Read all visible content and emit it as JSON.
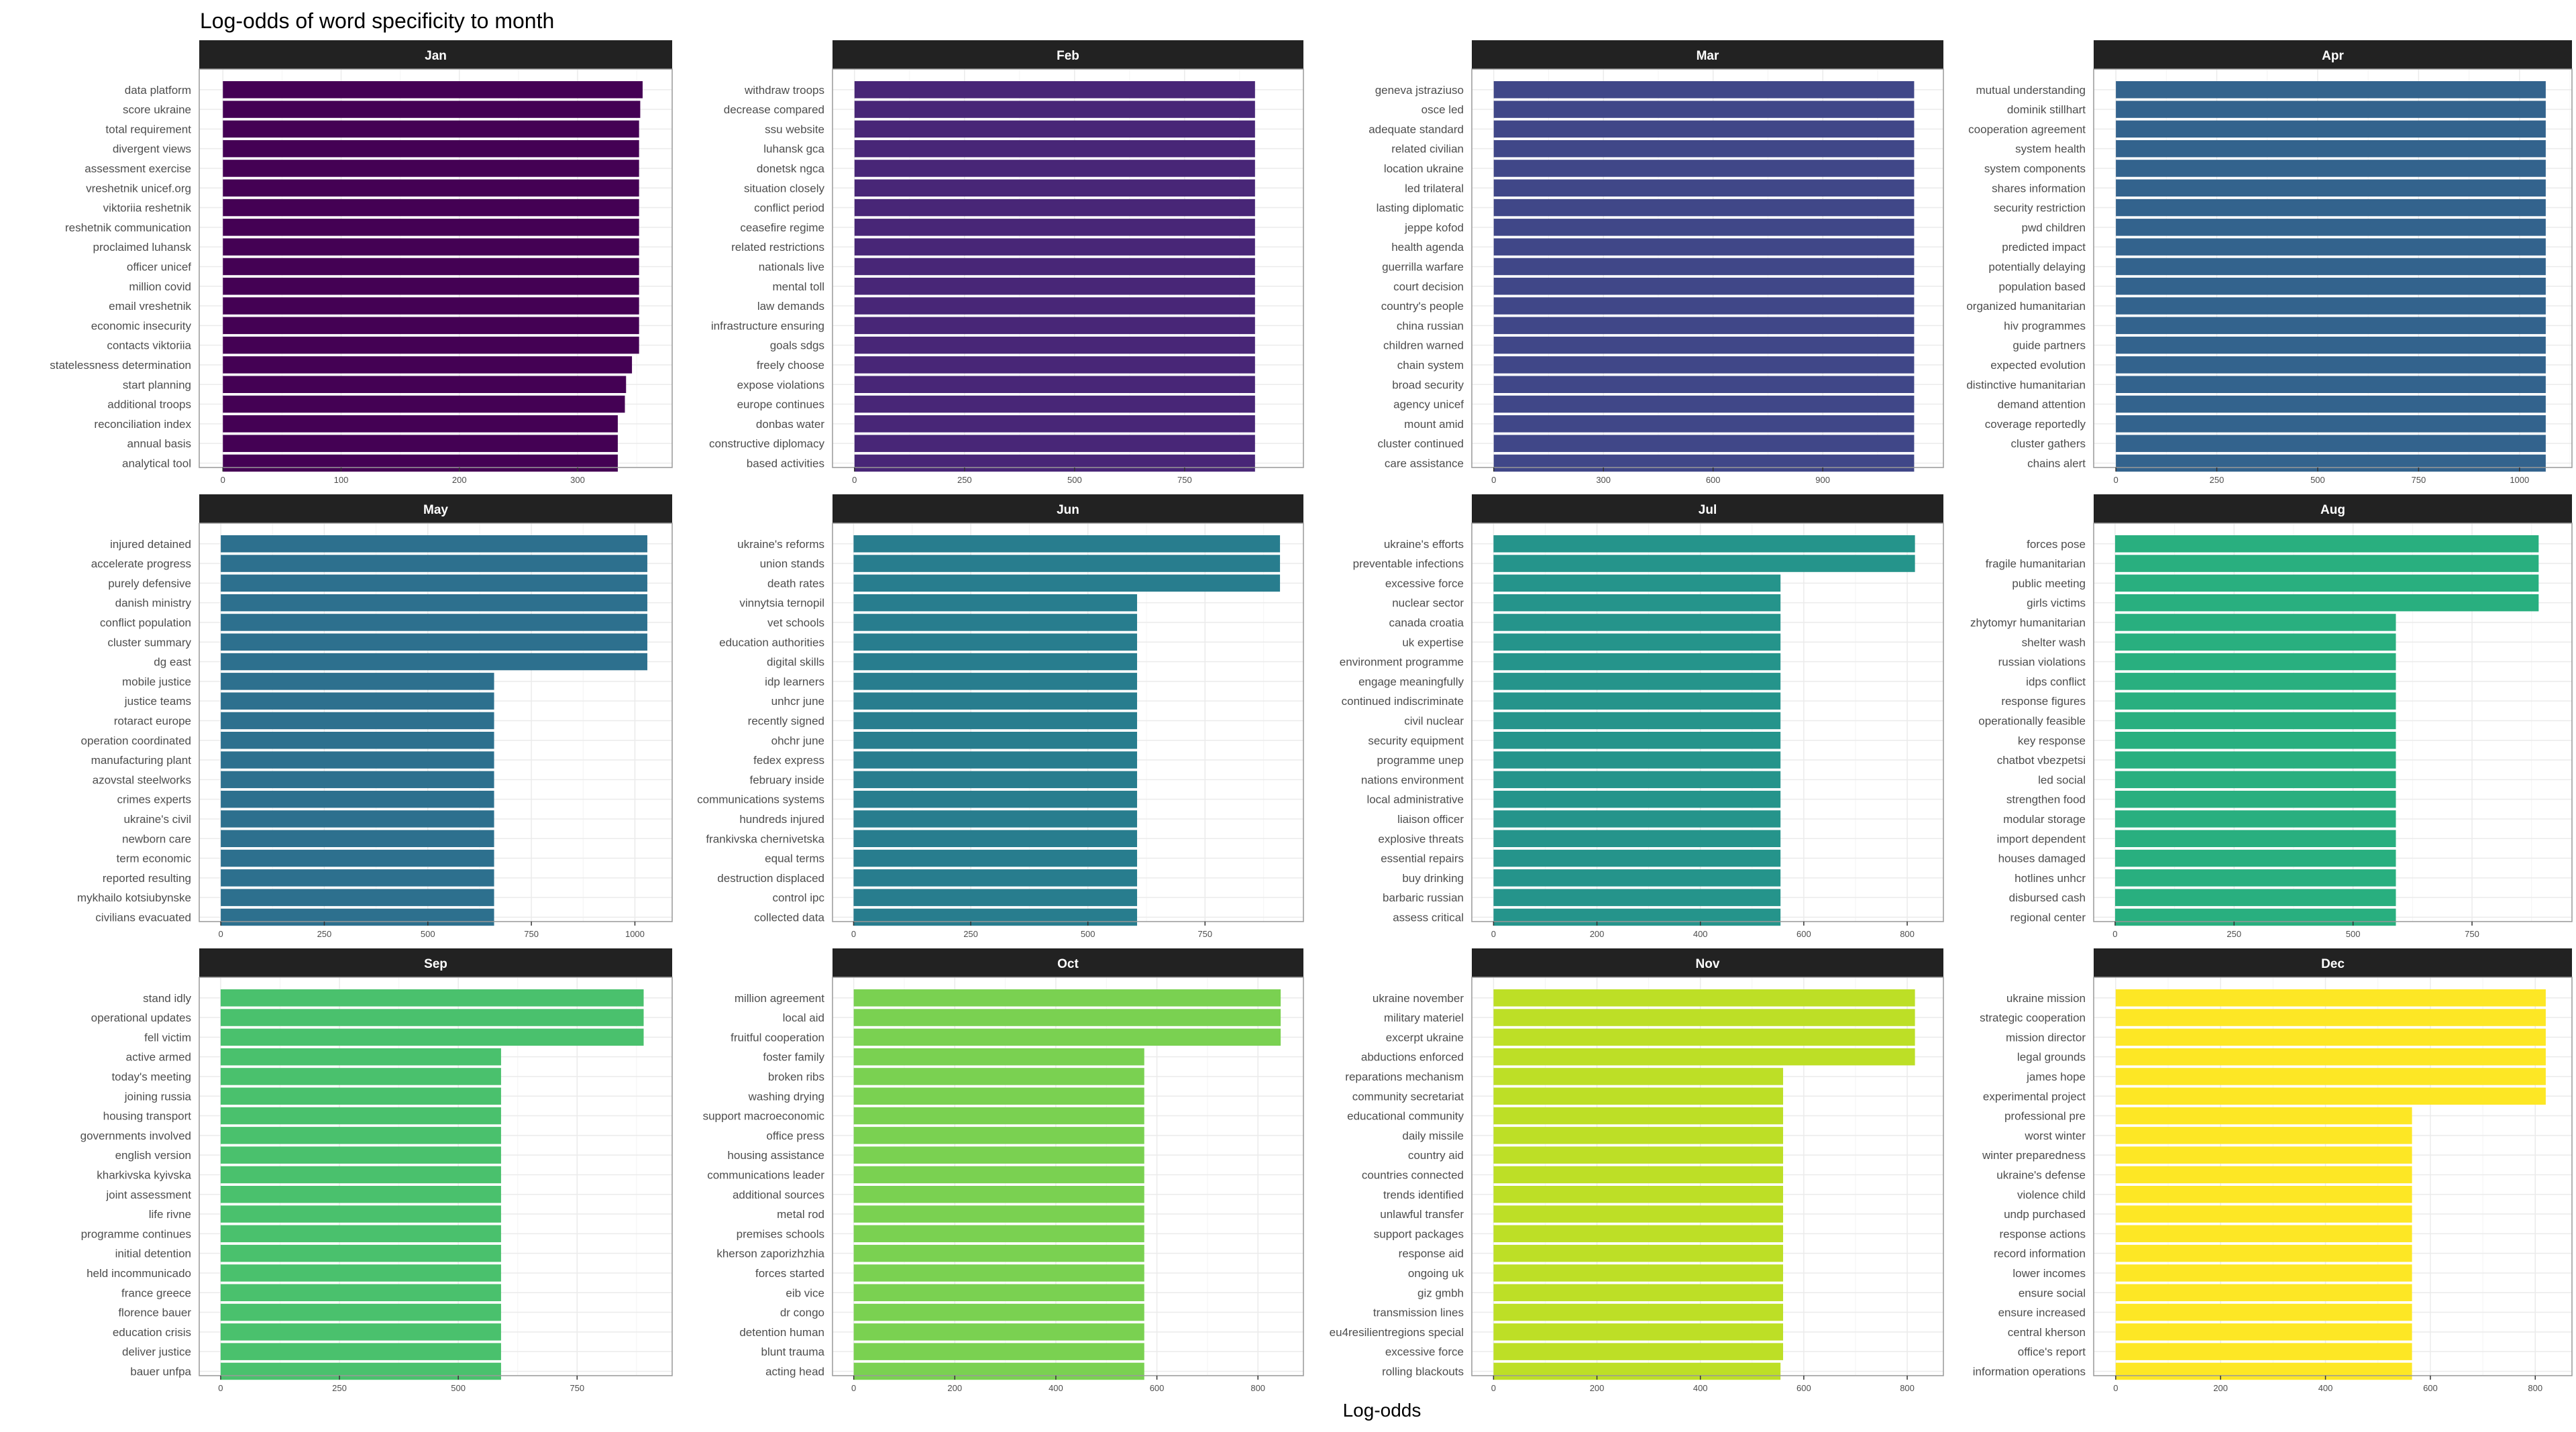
{
  "title": "Log-odds of word specificity to month",
  "xlabel": "Log-odds",
  "colors": {
    "strip_bg": "#222222",
    "strip_text": "#ffffff",
    "grid": "#ebebeb",
    "panel_border": "#999999",
    "label_text": "#4d4d4d",
    "tick_text": "#4d4d4d"
  },
  "chart_data": [
    {
      "type": "bar",
      "orientation": "horizontal",
      "panel": "Jan",
      "color": "#440154",
      "xlim": [
        -20,
        380
      ],
      "xticks": [
        0,
        100,
        200,
        300
      ],
      "categories": [
        "data platform",
        "score ukraine",
        "total requirement",
        "divergent views",
        "assessment exercise",
        "vreshetnik unicef.org",
        "viktoriia reshetnik",
        "reshetnik communication",
        "proclaimed luhansk",
        "officer unicef",
        "million covid",
        "email vreshetnik",
        "economic insecurity",
        "contacts viktoriia",
        "statelessness determination",
        "start planning",
        "additional troops",
        "reconciliation index",
        "annual basis",
        "analytical tool"
      ],
      "values": [
        355,
        353,
        352,
        352,
        352,
        352,
        352,
        352,
        352,
        352,
        352,
        352,
        352,
        352,
        346,
        341,
        340,
        334,
        334,
        334
      ]
    },
    {
      "type": "bar",
      "orientation": "horizontal",
      "panel": "Feb",
      "color": "#482677",
      "xlim": [
        -50,
        1020
      ],
      "xticks": [
        0,
        250,
        500,
        750
      ],
      "categories": [
        "withdraw troops",
        "decrease compared",
        "ssu website",
        "luhansk gca",
        "donetsk ngca",
        "situation closely",
        "conflict period",
        "ceasefire regime",
        "related restrictions",
        "nationals live",
        "mental toll",
        "law demands",
        "infrastructure ensuring",
        "goals sdgs",
        "freely choose",
        "expose violations",
        "europe continues",
        "donbas water",
        "constructive diplomacy",
        "based activities"
      ],
      "values": [
        910,
        910,
        910,
        910,
        910,
        910,
        910,
        910,
        910,
        910,
        910,
        910,
        910,
        910,
        910,
        910,
        910,
        910,
        910,
        910
      ]
    },
    {
      "type": "bar",
      "orientation": "horizontal",
      "panel": "Mar",
      "color": "#404788",
      "xlim": [
        -60,
        1230
      ],
      "xticks": [
        0,
        300,
        600,
        900
      ],
      "categories": [
        "geneva jstraziuso",
        "osce led",
        "adequate standard",
        "related civilian",
        "location ukraine",
        "led trilateral",
        "lasting diplomatic",
        "jeppe kofod",
        "health agenda",
        "guerrilla warfare",
        "court decision",
        "country's people",
        "china russian",
        "children warned",
        "chain system",
        "broad security",
        "agency unicef",
        "mount amid",
        "cluster continued",
        "care assistance"
      ],
      "values": [
        1150,
        1150,
        1150,
        1150,
        1150,
        1150,
        1150,
        1150,
        1150,
        1150,
        1150,
        1150,
        1150,
        1150,
        1150,
        1150,
        1150,
        1150,
        1150,
        1150
      ]
    },
    {
      "type": "bar",
      "orientation": "horizontal",
      "panel": "Apr",
      "color": "#33638d",
      "xlim": [
        -55,
        1130
      ],
      "xticks": [
        0,
        250,
        500,
        750,
        1000
      ],
      "categories": [
        "mutual understanding",
        "dominik stillhart",
        "cooperation agreement",
        "system health",
        "system components",
        "shares information",
        "security restriction",
        "pwd children",
        "predicted impact",
        "potentially delaying",
        "population based",
        "organized humanitarian",
        "hiv programmes",
        "guide partners",
        "expected evolution",
        "distinctive humanitarian",
        "demand attention",
        "coverage reportedly",
        "cluster gathers",
        "chains alert"
      ],
      "values": [
        1065,
        1065,
        1065,
        1065,
        1065,
        1065,
        1065,
        1065,
        1065,
        1065,
        1065,
        1065,
        1065,
        1065,
        1065,
        1065,
        1065,
        1065,
        1065,
        1065
      ]
    },
    {
      "type": "bar",
      "orientation": "horizontal",
      "panel": "May",
      "color": "#2d708e",
      "xlim": [
        -52,
        1090
      ],
      "xticks": [
        0,
        250,
        500,
        750,
        1000
      ],
      "categories": [
        "injured detained",
        "accelerate progress",
        "purely defensive",
        "danish ministry",
        "conflict population",
        "cluster summary",
        "dg east",
        "mobile justice",
        "justice teams",
        "rotaract europe",
        "operation coordinated",
        "manufacturing plant",
        "azovstal steelworks",
        "crimes experts",
        "ukraine's civil",
        "newborn care",
        "term economic",
        "reported resulting",
        "mykhailo kotsiubynske",
        "civilians evacuated"
      ],
      "values": [
        1030,
        1030,
        1030,
        1030,
        1030,
        1030,
        1030,
        660,
        660,
        660,
        660,
        660,
        660,
        660,
        660,
        660,
        660,
        660,
        660,
        660
      ]
    },
    {
      "type": "bar",
      "orientation": "horizontal",
      "panel": "Jun",
      "color": "#287d8e",
      "xlim": [
        -45,
        960
      ],
      "xticks": [
        0,
        250,
        500,
        750
      ],
      "categories": [
        "ukraine's reforms",
        "union stands",
        "death rates",
        "vinnytsia ternopil",
        "vet schools",
        "education authorities",
        "digital skills",
        "idp learners",
        "unhcr june",
        "recently signed",
        "ohchr june",
        "fedex express",
        "february inside",
        "communications systems",
        "hundreds injured",
        "frankivska chernivetska",
        "equal terms",
        "destruction displaced",
        "control ipc",
        "collected data"
      ],
      "values": [
        910,
        910,
        910,
        605,
        605,
        605,
        605,
        605,
        605,
        605,
        605,
        605,
        605,
        605,
        605,
        605,
        605,
        605,
        605,
        605
      ]
    },
    {
      "type": "bar",
      "orientation": "horizontal",
      "panel": "Jul",
      "color": "#25948b",
      "xlim": [
        -42,
        870
      ],
      "xticks": [
        0,
        200,
        400,
        600,
        800
      ],
      "categories": [
        "ukraine's efforts",
        "preventable infections",
        "excessive force",
        "nuclear sector",
        "canada croatia",
        "uk expertise",
        "environment programme",
        "engage meaningfully",
        "continued indiscriminate",
        "civil nuclear",
        "security equipment",
        "programme unep",
        "nations environment",
        "local administrative",
        "liaison officer",
        "explosive threats",
        "essential repairs",
        "buy drinking",
        "barbaric russian",
        "assess critical"
      ],
      "values": [
        815,
        815,
        555,
        555,
        555,
        555,
        555,
        555,
        555,
        555,
        555,
        555,
        555,
        555,
        555,
        555,
        555,
        555,
        555,
        555
      ]
    },
    {
      "type": "bar",
      "orientation": "horizontal",
      "panel": "Aug",
      "color": "#29af7f",
      "xlim": [
        -45,
        960
      ],
      "xticks": [
        0,
        250,
        500,
        750
      ],
      "categories": [
        "forces pose",
        "fragile humanitarian",
        "public meeting",
        "girls victims",
        "zhytomyr humanitarian",
        "shelter wash",
        "russian violations",
        "idps conflict",
        "response figures",
        "operationally feasible",
        "key response",
        "chatbot vbezpetsi",
        "led social",
        "strengthen food",
        "modular storage",
        "import dependent",
        "houses damaged",
        "hotlines unhcr",
        "disbursed cash",
        "regional center"
      ],
      "values": [
        890,
        890,
        890,
        890,
        590,
        590,
        590,
        590,
        590,
        590,
        590,
        590,
        590,
        590,
        590,
        590,
        590,
        590,
        590,
        590
      ]
    },
    {
      "type": "bar",
      "orientation": "horizontal",
      "panel": "Sep",
      "color": "#4ac16d",
      "xlim": [
        -45,
        950
      ],
      "xticks": [
        0,
        250,
        500,
        750
      ],
      "categories": [
        "stand idly",
        "operational updates",
        "fell victim",
        "active armed",
        "today's meeting",
        "joining russia",
        "housing transport",
        "governments involved",
        "english version",
        "kharkivska kyivska",
        "joint assessment",
        "life rivne",
        "programme continues",
        "initial detention",
        "held incommunicado",
        "france greece",
        "florence bauer",
        "education crisis",
        "deliver justice",
        "bauer unfpa"
      ],
      "values": [
        890,
        890,
        890,
        590,
        590,
        590,
        590,
        590,
        590,
        590,
        590,
        590,
        590,
        590,
        590,
        590,
        590,
        590,
        590,
        590
      ]
    },
    {
      "type": "bar",
      "orientation": "horizontal",
      "panel": "Oct",
      "color": "#7ad151",
      "xlim": [
        -42,
        890
      ],
      "xticks": [
        0,
        200,
        400,
        600,
        800
      ],
      "categories": [
        "million agreement",
        "local aid",
        "fruitful cooperation",
        "foster family",
        "broken ribs",
        "washing drying",
        "support macroeconomic",
        "office press",
        "housing assistance",
        "communications leader",
        "additional sources",
        "metal rod",
        "premises schools",
        "kherson zaporizhzhia",
        "forces started",
        "eib vice",
        "dr congo",
        "detention human",
        "blunt trauma",
        "acting head"
      ],
      "values": [
        845,
        845,
        845,
        575,
        575,
        575,
        575,
        575,
        575,
        575,
        575,
        575,
        575,
        575,
        575,
        575,
        575,
        575,
        575,
        575
      ]
    },
    {
      "type": "bar",
      "orientation": "horizontal",
      "panel": "Nov",
      "color": "#bddf26",
      "xlim": [
        -42,
        870
      ],
      "xticks": [
        0,
        200,
        400,
        600,
        800
      ],
      "categories": [
        "ukraine november",
        "military materiel",
        "excerpt ukraine",
        "abductions enforced",
        "reparations mechanism",
        "community secretariat",
        "educational community",
        "daily missile",
        "country aid",
        "countries connected",
        "trends identified",
        "unlawful transfer",
        "support packages",
        "response aid",
        "ongoing uk",
        "giz gmbh",
        "transmission lines",
        "eu4resilientregions special",
        "excessive force",
        "rolling blackouts"
      ],
      "values": [
        815,
        815,
        815,
        815,
        560,
        560,
        560,
        560,
        560,
        560,
        560,
        560,
        560,
        560,
        560,
        560,
        560,
        560,
        560,
        555
      ]
    },
    {
      "type": "bar",
      "orientation": "horizontal",
      "panel": "Dec",
      "color": "#fde725",
      "xlim": [
        -42,
        870
      ],
      "xticks": [
        0,
        200,
        400,
        600,
        800
      ],
      "categories": [
        "ukraine mission",
        "strategic cooperation",
        "mission director",
        "legal grounds",
        "james hope",
        "experimental project",
        "professional pre",
        "worst winter",
        "winter preparedness",
        "ukraine's defense",
        "violence child",
        "undp purchased",
        "response actions",
        "record information",
        "lower incomes",
        "ensure social",
        "ensure increased",
        "central kherson",
        "office's report",
        "information operations"
      ],
      "values": [
        820,
        820,
        820,
        820,
        820,
        820,
        565,
        565,
        565,
        565,
        565,
        565,
        565,
        565,
        565,
        565,
        565,
        565,
        565,
        565
      ]
    }
  ]
}
